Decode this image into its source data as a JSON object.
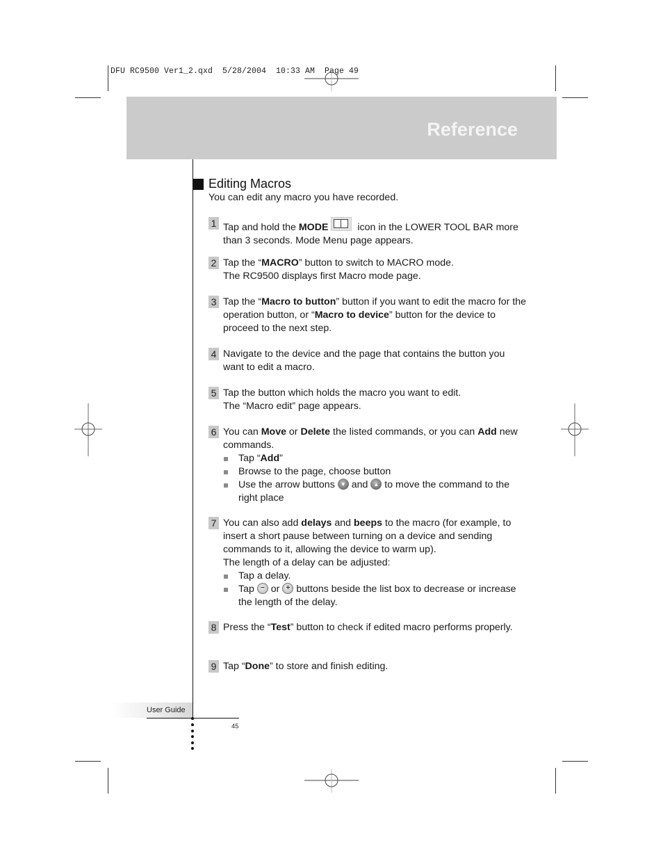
{
  "slug_line": "DFU RC9500 Ver1_2.qxd  5/28/2004  10:33 AM  Page 49",
  "header": {
    "title": "Reference"
  },
  "section": {
    "title": "Editing Macros",
    "intro": "You can edit any macro you have recorded."
  },
  "steps": [
    {
      "num": "1",
      "parts": [
        "Tap and hold the ",
        "MODE",
        " icon in the LOWER TOOL BAR more than 3 seconds. Mode Menu page appears."
      ],
      "icon": "mode-book-icon"
    },
    {
      "num": "2",
      "parts": [
        "Tap the “",
        "MACRO",
        "” button to switch to MACRO mode.",
        "The RC9500 displays first Macro mode page."
      ]
    },
    {
      "num": "3",
      "parts": [
        "Tap the “",
        "Macro to button",
        "” button if you want to edit the macro for the operation button, or “",
        "Macro to device",
        "” button for the device to proceed to the next step."
      ]
    },
    {
      "num": "4",
      "text": "Navigate to the device and the page that contains the button you want to edit a macro."
    },
    {
      "num": "5",
      "text": "Tap the button which holds the macro you want to edit.",
      "text2": "The “Macro edit” page appears."
    },
    {
      "num": "6",
      "parts": [
        "You can ",
        "Move",
        " or ",
        "Delete",
        " the listed commands, or you can ",
        "Add",
        " new commands."
      ],
      "bullets": [
        {
          "pre": "Tap “",
          "bold": "Add",
          "post": "”"
        },
        {
          "text": "Browse to the page, choose button"
        },
        {
          "pre": "Use the arrow buttons",
          "mid": "and",
          "post": "to move the command to the right place"
        }
      ]
    },
    {
      "num": "7",
      "parts": [
        "You can also add ",
        "delays",
        " and ",
        "beeps",
        " to the macro (for example, to insert a short pause between turning on a device and sending commands to it, allowing the device to warm up).",
        "The length of a delay can be adjusted:"
      ],
      "bullets": [
        {
          "text": "Tap a delay."
        },
        {
          "pre": "Tap",
          "mid": "or",
          "post": "buttons beside the list box to decrease or increase the length of the delay."
        }
      ]
    },
    {
      "num": "8",
      "parts": [
        "Press the “",
        "Test",
        "” button to check if edited macro performs properly."
      ]
    },
    {
      "num": "9",
      "parts": [
        "Tap “",
        "Done",
        "” to store and finish editing."
      ]
    }
  ],
  "icons": {
    "arrow_down": "▾",
    "arrow_up": "▴",
    "minus": "−",
    "plus": "+"
  },
  "footer": {
    "label": "User Guide",
    "page_number": "45"
  }
}
